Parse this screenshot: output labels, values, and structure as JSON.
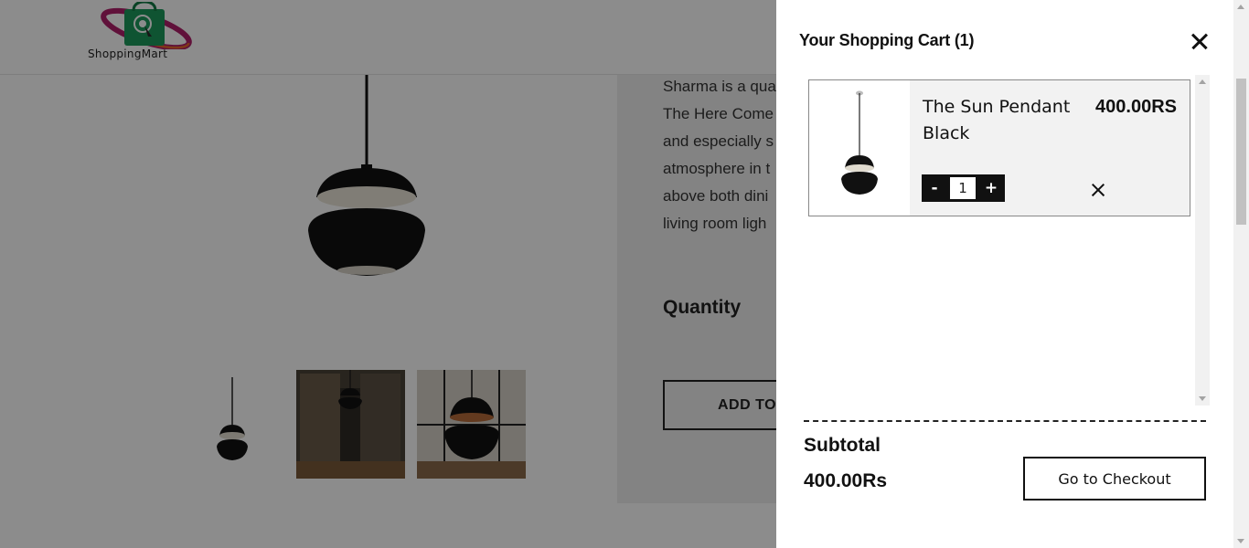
{
  "site": {
    "logo_text": "ShoppingMart"
  },
  "product": {
    "description_lines": [
      "Sharma is a qua",
      "The Here Come",
      "and especially s",
      "atmosphere in t",
      "above both dini",
      "living room ligh"
    ],
    "quantity_heading": "Quantity",
    "add_to_cart_label": "ADD TO CART"
  },
  "cart": {
    "title": "Your Shopping Cart (1)",
    "items": [
      {
        "name": "The Sun Pendant Black",
        "price": "400.00RS",
        "quantity": "1",
        "minus_label": "-",
        "plus_label": "+"
      }
    ],
    "subtotal_label": "Subtotal",
    "subtotal_value": "400.00Rs",
    "checkout_label": "Go to Checkout"
  },
  "icons": {
    "drawer_close": "close-icon",
    "item_remove": "close-icon",
    "logo": "shopping-bag-icon"
  },
  "colors": {
    "overlay": "#000000",
    "drawer_bg": "#ffffff",
    "item_bg": "#f2f2f2",
    "stepper_bg": "#111111"
  }
}
